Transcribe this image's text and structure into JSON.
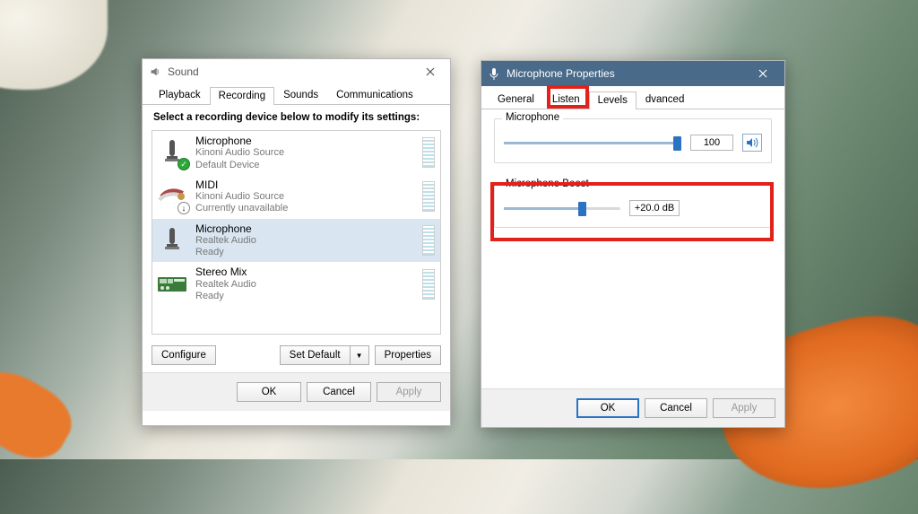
{
  "sound": {
    "title": "Sound",
    "tabs": [
      "Playback",
      "Recording",
      "Sounds",
      "Communications"
    ],
    "active_tab": 1,
    "instruction": "Select a recording device below to modify its settings:",
    "devices": [
      {
        "name": "Microphone",
        "line2": "Kinoni Audio Source",
        "line3": "Default Device",
        "badge": "ok"
      },
      {
        "name": "MIDI",
        "line2": "Kinoni Audio Source",
        "line3": "Currently unavailable",
        "badge": "down"
      },
      {
        "name": "Microphone",
        "line2": "Realtek Audio",
        "line3": "Ready",
        "badge": ""
      },
      {
        "name": "Stereo Mix",
        "line2": "Realtek Audio",
        "line3": "Ready",
        "badge": ""
      }
    ],
    "selected_device": 2,
    "buttons": {
      "configure": "Configure",
      "set_default": "Set Default",
      "properties": "Properties"
    },
    "ok": "OK",
    "cancel": "Cancel",
    "apply": "Apply"
  },
  "mic": {
    "title": "Microphone Properties",
    "tabs": [
      "General",
      "Listen",
      "Levels",
      "Advanced"
    ],
    "tab_levels_masked": "Levels",
    "tab_advanced_masked": "dvanced",
    "active_tab": 2,
    "group1": {
      "label": "Microphone",
      "value": "100",
      "slider_pct": 100
    },
    "group2": {
      "label": "Microphone Boost",
      "value": "+20.0 dB",
      "slider_pct": 67
    },
    "ok": "OK",
    "cancel": "Cancel",
    "apply": "Apply"
  }
}
